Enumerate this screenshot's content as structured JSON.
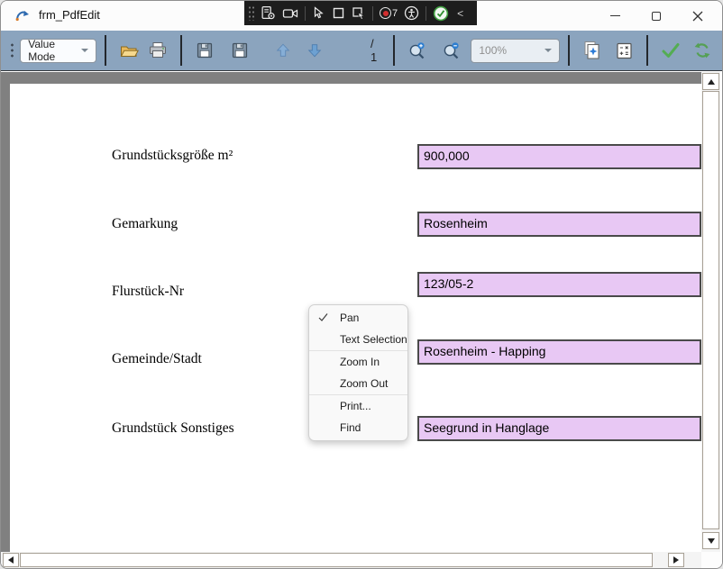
{
  "window": {
    "title": "frm_PdfEdit"
  },
  "capture_toolbar": {
    "icons": [
      "grip-dots",
      "form-settings",
      "camera",
      "cursor",
      "region",
      "cursor-region",
      "recording-indicator",
      "accessibility",
      "status-ok",
      "collapse"
    ],
    "recording_count": "7",
    "collapse_glyph": "<"
  },
  "toolbar": {
    "mode_dropdown": {
      "value": "Value Mode"
    },
    "icons": [
      "open-folder",
      "print",
      "save",
      "save-as",
      "page-up",
      "page-down",
      "zoom-in",
      "zoom-out",
      "new-page",
      "calculator",
      "apply-check",
      "refresh"
    ],
    "page_indicator": "/ 1",
    "zoom_dropdown": {
      "value": "100%"
    }
  },
  "document": {
    "fields": [
      {
        "label": "Grundstücksgröße m²",
        "value": "900,000"
      },
      {
        "label": "Gemarkung",
        "value": "Rosenheim"
      },
      {
        "label": "Flurstück-Nr",
        "value": "123/05-2"
      },
      {
        "label": "Gemeinde/Stadt",
        "value": "Rosenheim - Happing"
      },
      {
        "label": "Grundstück Sonstiges",
        "value": "Seegrund in Hanglage"
      }
    ]
  },
  "context_menu": {
    "items": [
      {
        "label": "Pan",
        "checked": true
      },
      {
        "label": "Text Selection",
        "checked": false
      },
      {
        "label": "Zoom In",
        "checked": false
      },
      {
        "label": "Zoom Out",
        "checked": false
      },
      {
        "label": "Print...",
        "checked": false
      },
      {
        "label": "Find",
        "checked": false
      }
    ]
  },
  "colors": {
    "toolbar_bg": "#8BA4BE",
    "capture_bar_bg": "#1D1D1D",
    "canvas_bg": "#808080",
    "field_bg": "#E8C8F4",
    "recording_dot": "#D32F2F",
    "success_green": "#4DA34D"
  }
}
